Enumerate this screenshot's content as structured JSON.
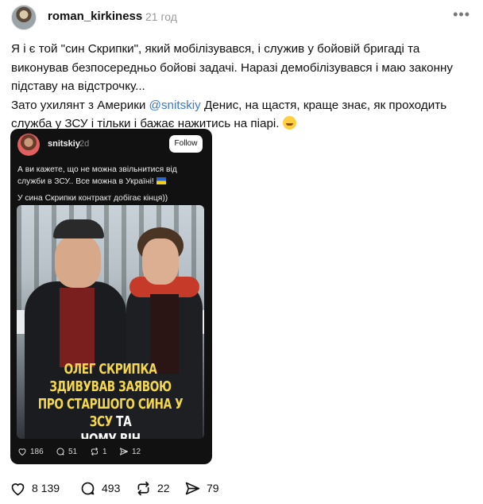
{
  "post": {
    "author": "roman_kirkiness",
    "time": "21 год",
    "more_label": "•••",
    "text_lines": [
      "Я і є той \"син Скрипки\", який мобілізувався, і служив у бойовій бригаді та",
      "виконував безпосередньо бойові задачі. Наразі демобілізувався і маю законну",
      "підставу на відстрочку...",
      "Зато ухилянт з Америки ",
      " Денис, на щастя, краще знає, як проходить",
      "служба у ЗСУ і тільки і бажає нажитись на піарі. "
    ],
    "mention": "@snitskiy",
    "stats": {
      "likes": "8 139",
      "replies": "493",
      "reposts": "22",
      "shares": "79"
    }
  },
  "quote": {
    "author": "snitskiy",
    "time": "2d",
    "follow_label": "Follow",
    "text_line1": "А ви кажете, що не можна звільнитися від",
    "text_line2": "служби в ЗСУ.. Все можна в Україні! ",
    "text_line3": "У сина Скрипки контракт добігає кінця))",
    "headline": {
      "line1": "ОЛЕГ СКРИПКА ЗДИВУВАВ ЗАЯВОЮ",
      "line2a": "ПРО СТАРШОГО СИНА У ЗСУ ",
      "line2b": "ТА",
      "line3": "ЧОМУ ВІН ПОВЕРТАЄТЬСЯ ДОДОМУ"
    },
    "stats": {
      "likes": "186",
      "replies": "51",
      "reposts": "1",
      "shares": "12"
    }
  },
  "icons": {
    "heart": "heart-icon",
    "reply": "speech-bubble-icon",
    "repost": "repost-arrows-icon",
    "share": "paper-plane-icon",
    "flag": "ukraine-flag-icon",
    "emoji": "grinning-face-icon"
  },
  "colors": {
    "mention": "#3f78c8",
    "headline_accent": "#f5d74a",
    "quote_bg": "#111111",
    "muted": "#9a9a9a"
  }
}
